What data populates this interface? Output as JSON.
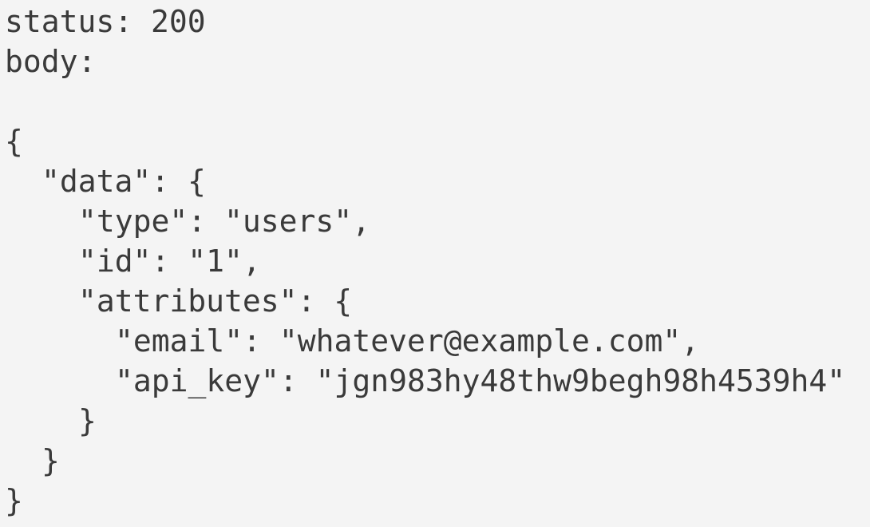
{
  "response": {
    "status_line": "status: 200",
    "body_label": "body:",
    "blank": "",
    "lines": [
      "{",
      "\"data\": {",
      "\"type\": \"users\",",
      "\"id\": \"1\",",
      "\"attributes\": {",
      "\"email\": \"whatever@example.com\",",
      "\"api_key\": \"jgn983hy48thw9begh98h4539h4\"",
      "}",
      "}",
      "}"
    ]
  }
}
